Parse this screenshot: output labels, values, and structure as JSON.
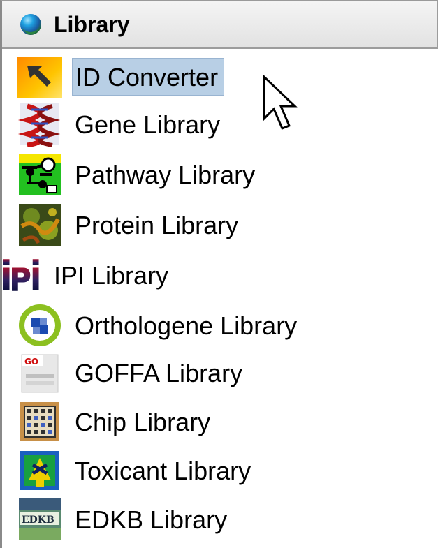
{
  "panel": {
    "title": "Library",
    "title_icon": "blue-sphere-icon"
  },
  "items": [
    {
      "label": "ID Converter",
      "icon": "arrow-nw-icon",
      "selected": true
    },
    {
      "label": "Gene Library",
      "icon": "dna-helix-icon",
      "selected": false
    },
    {
      "label": "Pathway Library",
      "icon": "pathway-graph-icon",
      "selected": false
    },
    {
      "label": "Protein Library",
      "icon": "protein-structure-icon",
      "selected": false
    },
    {
      "label": "IPI Library",
      "icon": "ipi-logo-icon",
      "selected": false
    },
    {
      "label": "Orthologene Library",
      "icon": "orthologene-ring-icon",
      "selected": false
    },
    {
      "label": "GOFFA Library",
      "icon": "go-logo-icon",
      "selected": false
    },
    {
      "label": "Chip Library",
      "icon": "microarray-chip-icon",
      "selected": false
    },
    {
      "label": "Toxicant Library",
      "icon": "toxicant-icon",
      "selected": false
    },
    {
      "label": "EDKB Library",
      "icon": "edkb-logo-icon",
      "selected": false
    }
  ],
  "colors": {
    "selection": "#b8cfe5",
    "header_bg": "#e8e8e8"
  }
}
